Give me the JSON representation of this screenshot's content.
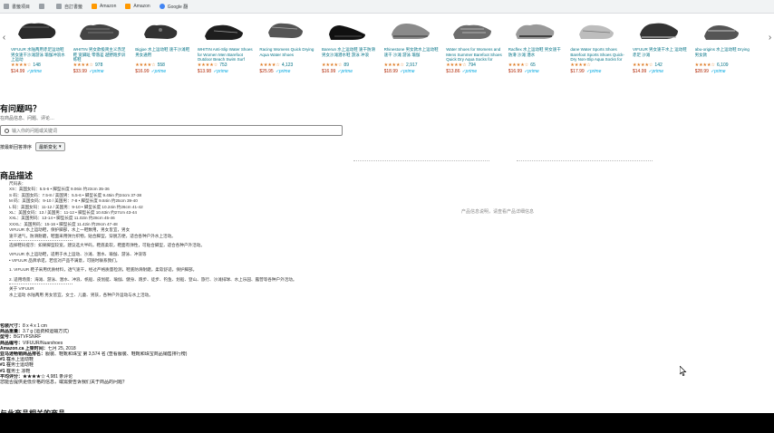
{
  "bookmarks": [
    {
      "label": "書籤項目",
      "icon": "folder-icon"
    },
    {
      "label": "",
      "icon": "folder-icon"
    },
    {
      "label": "自訂書籤",
      "icon": "bookmark-icon"
    },
    {
      "label": "Amazon",
      "icon": "amazon-icon"
    },
    {
      "label": "Amazon",
      "icon": "amazon-icon"
    },
    {
      "label": "Google 翻",
      "icon": "google-icon"
    }
  ],
  "carousel": {
    "items": [
      {
        "title": "VIFUUR 水陆两用赤足运动鞋 男女速干沙滩游泳 瑜伽冲浪水上运动",
        "stars": "★★★★☆",
        "count": "148",
        "price": "$14.99",
        "prime": "✓prime"
      },
      {
        "title": "WHITIN 男女款极简主义赤足鞋 宽脚趾 零落差 越野跑步训练鞋",
        "stars": "★★★★☆",
        "count": "978",
        "price": "$33.99",
        "prime": "✓prime"
      },
      {
        "title": "Bigjoe 水上运动鞋 速干沙滩鞋 男女通用",
        "stars": "★★★★☆",
        "count": "558",
        "price": "$16.99",
        "prime": "✓prime"
      },
      {
        "title": "WHITIN Anti-Slip Water Shoes for Women Men Barefoot Outdoor Beach Swim Surf Pool SNKRL",
        "stars": "★★★★☆",
        "count": "753",
        "price": "$13.98",
        "prime": "✓prime"
      },
      {
        "title": "Racing Womens Quick Drying Aqua Water Shoes",
        "stars": "★★★★☆",
        "count": "4,123",
        "price": "$25.95",
        "prime": "✓prime"
      },
      {
        "title": "Barerun 水上运动鞋 速干防滑 男女沙滩潜水鞋 游泳 冲浪",
        "stars": "★★★★☆",
        "count": "89",
        "price": "$16.99",
        "prime": "✓prime"
      },
      {
        "title": "Rhinestone 男女款水上运动鞋 速干 沙滩 游泳 瑜伽",
        "stars": "★★★★☆",
        "count": "2,917",
        "price": "$18.99",
        "prime": "✓prime"
      },
      {
        "title": "Water Shoes for Womens and Mens Summer Barefoot Shoes Quick Dry Aqua Socks for Swim",
        "stars": "★★★★☆",
        "count": "794",
        "price": "$13.86",
        "prime": "✓prime"
      },
      {
        "title": "Racflex 水上运动鞋 男女速干 防滑 沙滩 潜水",
        "stars": "★★★★☆",
        "count": "65",
        "price": "$16.99",
        "prime": "✓prime"
      },
      {
        "title": "dane Water Sports Shoes Barefoot Sports Shoes Quick-Dry Non-Slip Aqua Socks for Swim",
        "stars": "★★★★☆",
        "count": "",
        "price": "$17.99",
        "prime": "✓prime"
      },
      {
        "title": "VIFUUR 男女速干水上 运动鞋 赤足 沙滩",
        "stars": "★★★★☆",
        "count": "142",
        "price": "$14.99",
        "prime": "✓prime"
      },
      {
        "title": "abu-origins 水上运动鞋 Drying 男女款",
        "stars": "★★★★☆",
        "count": "6,109",
        "price": "$28.99",
        "prime": "✓prime"
      }
    ]
  },
  "qa": {
    "title": "有问题吗？",
    "subtitle": "在商品信息、问题、评论…",
    "placeholder": "输入你的问题或关键词",
    "sort_label": "按最新回答排序",
    "sort_value": "最新变化"
  },
  "description": {
    "title": "商品描述",
    "lines": [
      "尺码表：",
      "",
      "XS：美国女码：5.5-6 • 脚型长度 9.06in 约23cm 35-36",
      "S 码：美国女码：7.5-8 / 美国男：5.5-6 • 脚型长度 9.45in 约24cm 37-38",
      "M 码：美国女码：9-10 / 美国男：7-8 • 脚型长度 9.84in 约25cm 39-40",
      "L 码：美国女码：11-12 / 美国男：9-10 • 脚型长度 10.24in 约26cm 41-42",
      "XL：美国女码：13 / 美国男：11-12 • 脚型长度 10.63in 约27cm 43-44",
      "XXL：美国男码：13-14 • 脚型长度 11.02in 约28cm 45-46",
      "XXXL：美国男码：15-16 • 脚型长度 11.42in 约29cm 47-48",
      "VIFUUR 水上运动鞋，保护脚部，水上一鞋数用，男女皆宜，男女",
      "速干透气，防滑耐磨，鞋面采用弹力织物，贴合脚型，穿脱方便，适合各种户外水上活动。",
      "---sep",
      "选择鞋码提示：如果脚型较宽，建议选大半码，鞋底柔软，鞋面有弹性，可贴合脚型，适合各种户外活动。",
      "---gap",
      "VIFUUR 水上运动鞋，适用于水上运动、沙滩、潜水、瑜伽、游泳、冲浪等",
      "• VIFUUR 品牌承诺，若您对产品不满意，可随时联系我们。",
      "---gap",
      "1. VIFUUR 鞋子采用优质材料，透气速干，经过严格质量检测，鞋底防滑耐磨，柔软舒适，保护脚部。",
      "---gap",
      "2. 适用场景：海滩、游泳、潜水、冲浪、帆船、皮划艇、瑜伽、健身、跑步、徒步、钓鱼、划船、登山、旅行、沙滩排球、水上乐园、露营等各种户外活动。",
      "---sep",
      "关于 VIFUUR",
      "水上运动 水陆两用 男女皆宜，女士、儿童、男孩，各种户外运动与水上活动。"
    ],
    "side_note": "产品信息说明，请查看产品详细信息"
  },
  "details": {
    "rows": [
      {
        "label": "包装尺寸：",
        "value": "8 x 4 x 1 cm"
      },
      {
        "label": "商品重量：",
        "value": "3.7 g (运费和运输方式)"
      },
      {
        "label": "型号：",
        "value": "BGTVFSNRF"
      },
      {
        "label": "商品编号：",
        "value": "VIFUUR/Nuarshoes"
      },
      {
        "label": "Amazon.ca 上架时间：",
        "value": "七月 25, 2018"
      },
      {
        "label": "亚马逊畅销商品排名：",
        "value": "服装、鞋靴和珠宝 第 3,574 名 (查看服装、鞋靴和珠宝商品销售排行榜)"
      },
      {
        "label": "#1 在",
        "value": "水上运动鞋"
      },
      {
        "label": "#1 在",
        "value": "男士运动鞋"
      },
      {
        "label": "#1 在",
        "value": "男士 凉鞋"
      },
      {
        "label": "平均评分：",
        "value": "★★★★☆  4,981 条评论"
      },
      {
        "label": "",
        "value": "您能否提供更低价格的信息，或需要告诉我们关于商品的问题？"
      }
    ]
  },
  "bottom": {
    "title": "与此商品相关的商品"
  }
}
